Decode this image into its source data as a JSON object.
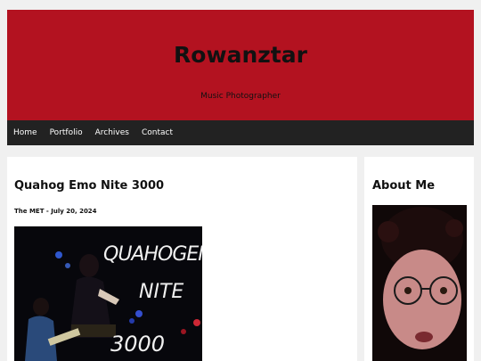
{
  "site": {
    "title": "Rowanztar",
    "tagline": "Music Photographer"
  },
  "nav": {
    "items": [
      "Home",
      "Portfolio",
      "Archives",
      "Contact"
    ]
  },
  "post": {
    "title": "Quahog Emo Nite 3000",
    "meta": "The MET - July 20, 2024"
  },
  "sidebar": {
    "widget_title": "About Me"
  },
  "colors": {
    "header_bg": "#b31220",
    "nav_bg": "#222222",
    "page_bg": "#f0f0f0"
  }
}
